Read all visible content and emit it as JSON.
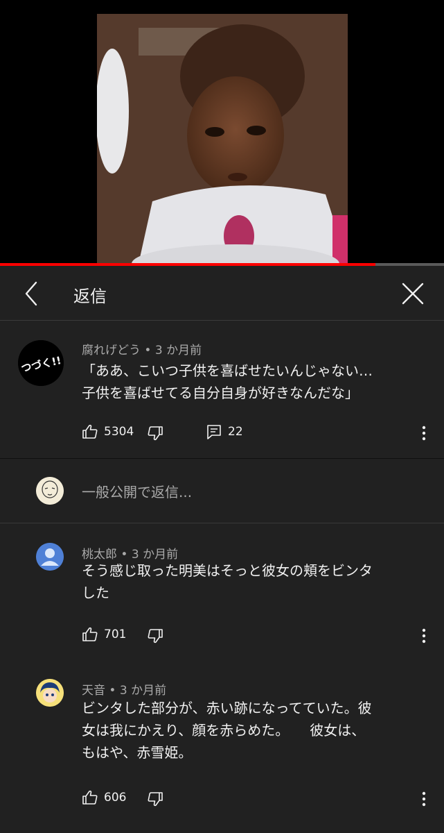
{
  "header": {
    "title": "返信"
  },
  "video": {
    "progress": 0.845
  },
  "parent_comment": {
    "author": "腐れげどう",
    "time": "3 か月前",
    "avatar_text": "つづく!!",
    "lines": [
      "「ああ、こいつ子供を喜ばせたいんじゃない…",
      "子供を喜ばせてる自分自身が好きなんだな」"
    ],
    "likes": "5304",
    "replies": "22"
  },
  "reply_box": {
    "placeholder": "一般公開で返信..."
  },
  "replies": [
    {
      "author": "桃太郎",
      "time": "3 か月前",
      "lines": [
        "そう感じ取った明美はそっと彼女の頬をビンタ",
        "した"
      ],
      "likes": "701"
    },
    {
      "author": "天音",
      "time": "3 か月前",
      "lines": [
        "ビンタした部分が、赤い跡になってていた。彼",
        "女は我にかえり、顔を赤らめた。　　彼女は、",
        "もはや、赤雪姫。"
      ],
      "likes": "606"
    }
  ],
  "meta_separator": "•",
  "colors": {
    "background": "#212121",
    "video_bg": "#000000",
    "progress": "#ff0000",
    "text": "#f1f1f1",
    "meta": "#aaaaaa",
    "default_avatar": "#4f80d6"
  }
}
